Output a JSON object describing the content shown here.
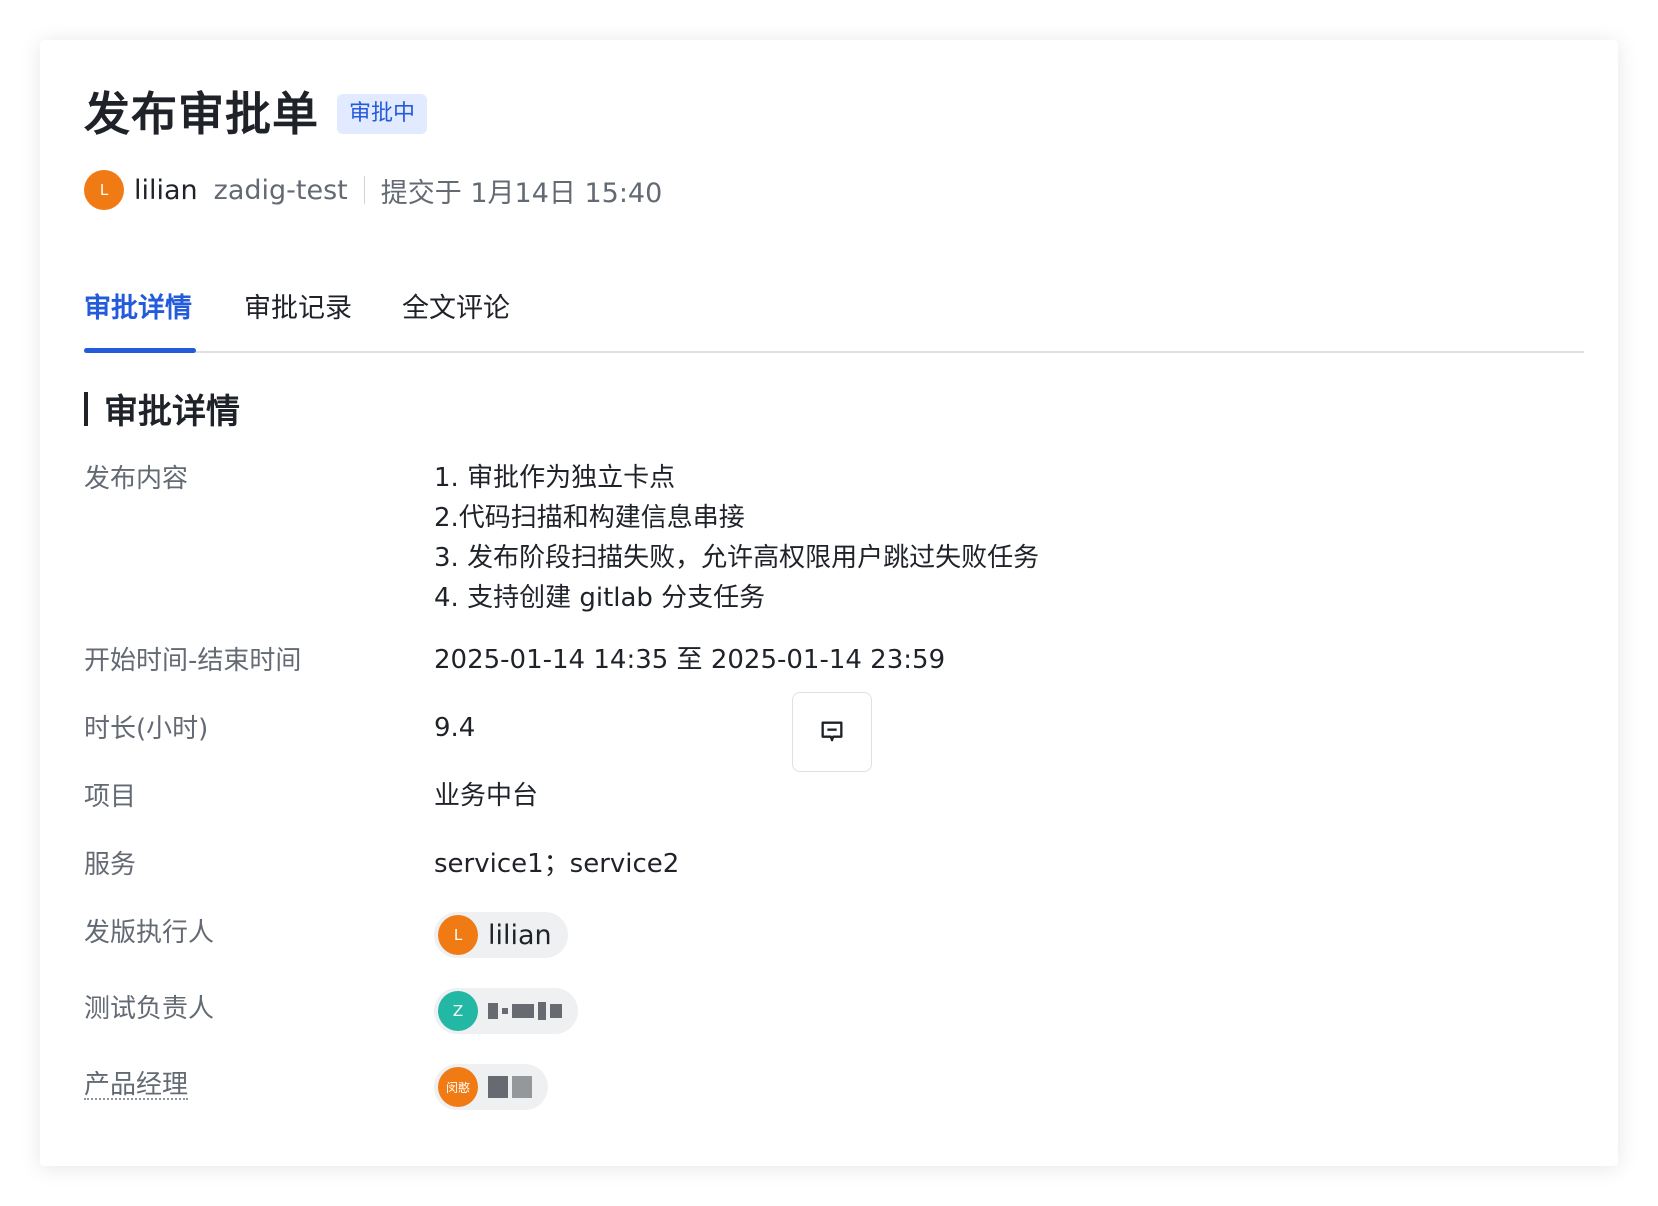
{
  "header": {
    "title": "发布审批单",
    "status": "审批中",
    "submitter_initial": "L",
    "submitter_name": "lilian",
    "organization": "zadig-test",
    "submitted_at": "提交于 1月14日 15:40"
  },
  "tabs": [
    {
      "label": "审批详情",
      "active": true
    },
    {
      "label": "审批记录",
      "active": false
    },
    {
      "label": "全文评论",
      "active": false
    }
  ],
  "section": {
    "title": "审批详情"
  },
  "details": {
    "content_label": "发布内容",
    "content_lines": [
      "1. 审批作为独立卡点",
      "2.代码扫描和构建信息串接",
      "3. 发布阶段扫描失败，允许高权限用户跳过失败任务",
      "4. 支持创建 gitlab 分支任务"
    ],
    "time_label": "开始时间-结束时间",
    "time_value": "2025-01-14 14:35 至 2025-01-14 23:59",
    "duration_label": "时长(小时)",
    "duration_value": "9.4",
    "project_label": "项目",
    "project_value": "业务中台",
    "service_label": "服务",
    "service_value": "service1；service2",
    "executor_label": "发版执行人",
    "executor_initial": "L",
    "executor_name": "lilian",
    "tester_label": "测试负责人",
    "tester_initial": "Z",
    "pm_label": "产品经理",
    "pm_initial": "闵憨"
  },
  "colors": {
    "accent": "#245bdb",
    "badge_bg": "#e1eaff",
    "avatar_orange": "#f07a13",
    "avatar_teal": "#23b8a3"
  },
  "icons": {
    "comment": "comment-icon"
  }
}
